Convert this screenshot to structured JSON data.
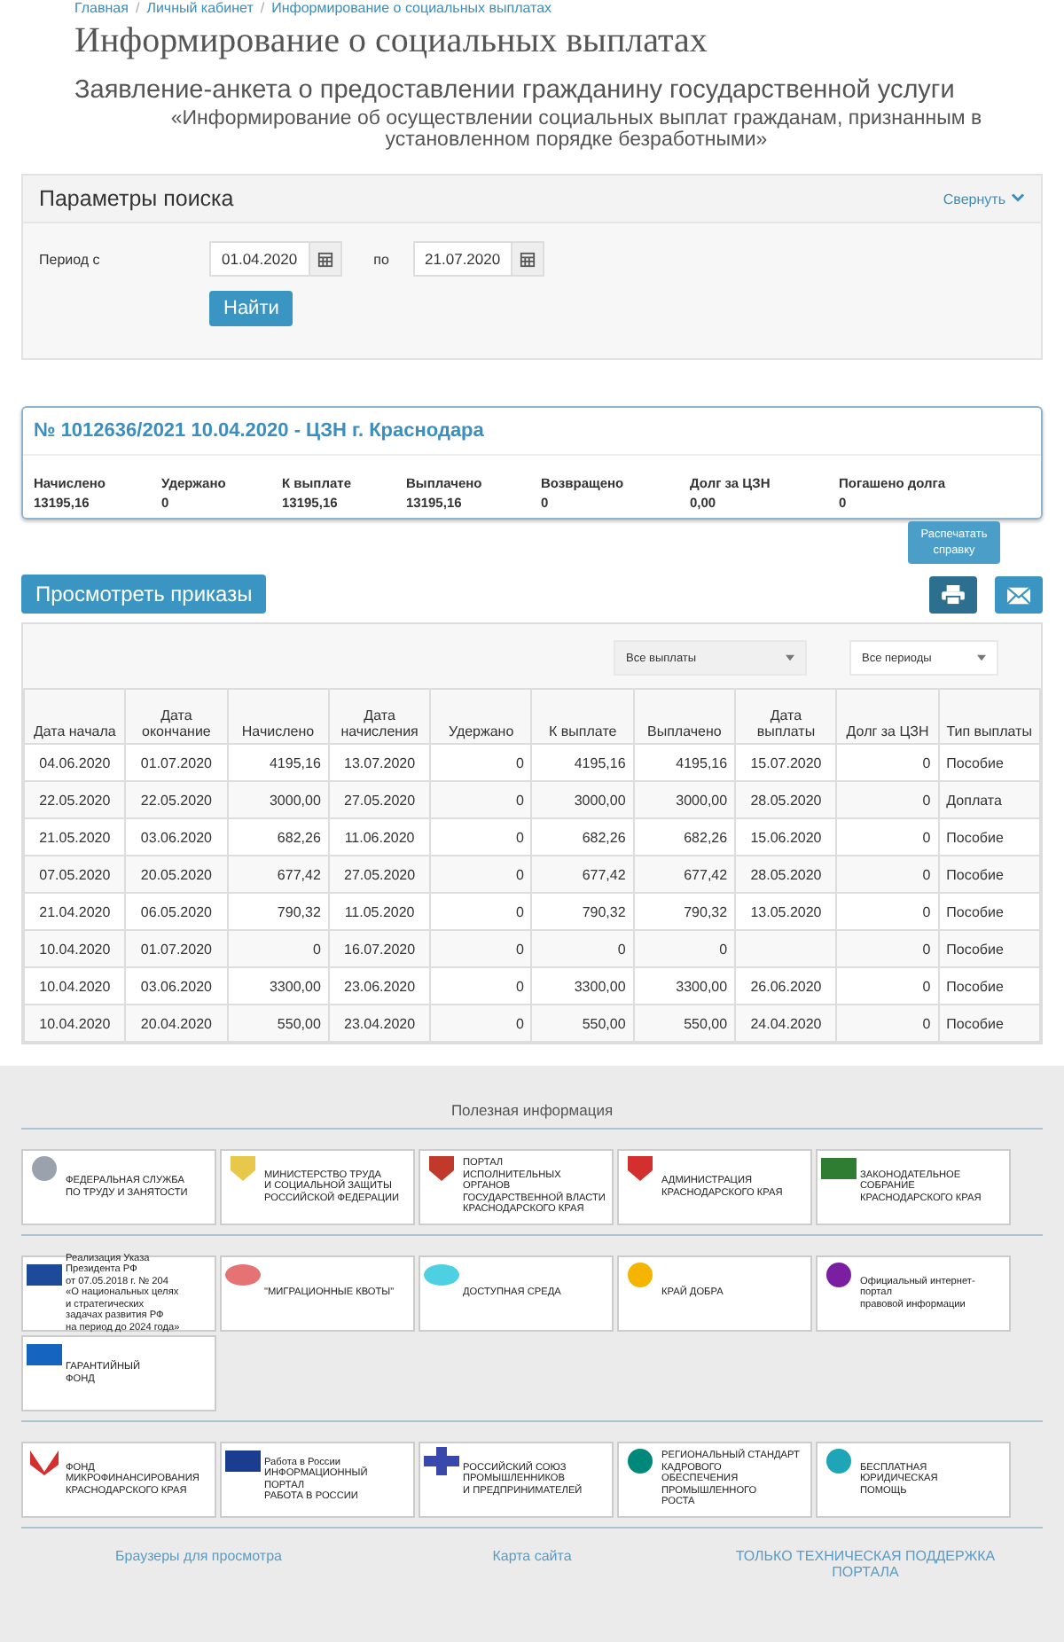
{
  "breadcrumb": {
    "separator": "/",
    "items": [
      "Главная",
      "Личный кабинет",
      "Информирование о социальных выплатах"
    ]
  },
  "title": "Информирование о социальных выплатах",
  "subtitle": "Заявление-анкета о предоставлении гражданину государственной услуги",
  "service_name": "«Информирование об осуществлении социальных выплат гражданам, признанным в установленном порядке безработными»",
  "search_panel": {
    "title": "Параметры поиска",
    "collapse_link": "Свернуть",
    "period_label": "Период с",
    "date_from": "01.04.2020",
    "to_label": "по",
    "date_to": "21.07.2020",
    "find_button": "Найти"
  },
  "summary": {
    "title": "№ 1012636/2021 10.04.2020 - ЦЗН г. Краснодара",
    "items": [
      {
        "label": "Начислено",
        "value": "13195,16"
      },
      {
        "label": "Удержано",
        "value": "0"
      },
      {
        "label": "К выплате",
        "value": "13195,16"
      },
      {
        "label": "Выплачено",
        "value": "13195,16"
      },
      {
        "label": "Возвращено",
        "value": "0"
      },
      {
        "label": "Долг за ЦЗН",
        "value": "0,00"
      },
      {
        "label": "Погашено долга",
        "value": "0"
      }
    ]
  },
  "actions": {
    "orders_button": "Просмотреть приказы",
    "print_tooltip": "Распечатать справку"
  },
  "table": {
    "filters": [
      "Все выплаты",
      "Все периоды"
    ],
    "columns": [
      {
        "label": "Дата начала",
        "kind": "date"
      },
      {
        "label": "Дата окончание",
        "kind": "date"
      },
      {
        "label": "Начислено",
        "kind": "number"
      },
      {
        "label": "Дата начисления",
        "kind": "date"
      },
      {
        "label": "Удержано",
        "kind": "number"
      },
      {
        "label": "К выплате",
        "kind": "number"
      },
      {
        "label": "Выплачено",
        "kind": "number"
      },
      {
        "label": "Дата выплаты",
        "kind": "date"
      },
      {
        "label": "Долг за ЦЗН",
        "kind": "number"
      },
      {
        "label": "Тип выплаты",
        "kind": "text"
      }
    ],
    "rows": [
      [
        "04.06.2020",
        "01.07.2020",
        "4195,16",
        "13.07.2020",
        "0",
        "4195,16",
        "4195,16",
        "15.07.2020",
        "0",
        "Пособие"
      ],
      [
        "22.05.2020",
        "22.05.2020",
        "3000,00",
        "27.05.2020",
        "0",
        "3000,00",
        "3000,00",
        "28.05.2020",
        "0",
        "Доплата"
      ],
      [
        "21.05.2020",
        "03.06.2020",
        "682,26",
        "11.06.2020",
        "0",
        "682,26",
        "682,26",
        "15.06.2020",
        "0",
        "Пособие"
      ],
      [
        "07.05.2020",
        "20.05.2020",
        "677,42",
        "27.05.2020",
        "0",
        "677,42",
        "677,42",
        "28.05.2020",
        "0",
        "Пособие"
      ],
      [
        "21.04.2020",
        "06.05.2020",
        "790,32",
        "11.05.2020",
        "0",
        "790,32",
        "790,32",
        "13.05.2020",
        "0",
        "Пособие"
      ],
      [
        "10.04.2020",
        "01.07.2020",
        "0",
        "16.07.2020",
        "0",
        "0",
        "0",
        null,
        "0",
        "Пособие"
      ],
      [
        "10.04.2020",
        "03.06.2020",
        "3300,00",
        "23.06.2020",
        "0",
        "3300,00",
        "3300,00",
        "26.06.2020",
        "0",
        "Пособие"
      ],
      [
        "10.04.2020",
        "20.04.2020",
        "550,00",
        "23.04.2020",
        "0",
        "550,00",
        "550,00",
        "24.04.2020",
        "0",
        "Пособие"
      ]
    ]
  },
  "footer": {
    "title": "Полезная информация",
    "banner_rows": [
      [
        {
          "kind": "emblem",
          "text": "ФЕДЕРАЛЬНАЯ СЛУЖБА\nПО ТРУДУ И ЗАНЯТОСТИ"
        },
        {
          "kind": "shield",
          "text": "МИНИСТЕРСТВО ТРУДА\nИ СОЦИАЛЬНОЙ ЗАЩИТЫ\nРОССИЙСКОЙ ФЕДЕРАЦИИ"
        },
        {
          "kind": "crest",
          "text": "ПОРТАЛ\nИСПОЛНИТЕЛЬНЫХ ОРГАНОВ\nГОСУДАРСТВЕННОЙ ВЛАСТИ\nКРАСНОДАРСКОГО КРАЯ"
        },
        {
          "kind": "red-crest",
          "text": "АДМИНИСТРАЦИЯ\nКРАСНОДАРСКОГО КРАЯ"
        },
        {
          "kind": "flag",
          "text": "ЗАКОНОДАТЕЛЬНОЕ\nСОБРАНИЕ\nКРАСНОДАРСКОГО КРАЯ"
        }
      ],
      [
        {
          "kind": "projects",
          "text": "Реализация Указа\nПрезидента РФ\nот 07.05.2018 г. № 204\n«О национальных целях\nи стратегических\nзадачах развития РФ\nна период до 2024 года»"
        },
        {
          "kind": "map",
          "text": "\"МИГРАЦИОННЫЕ КВОТЫ\""
        },
        {
          "kind": "cloud",
          "text": "ДОСТУПНАЯ СРЕДА"
        },
        {
          "kind": "dots",
          "text": "КРАЙ ДОБРА"
        },
        {
          "kind": "seal",
          "text": "Официальный интернет-портал\nправовой информации"
        },
        {
          "kind": "stripes",
          "text": "ГАРАНТИЙНЫЙ\nФОНД"
        }
      ],
      [
        {
          "kind": "check",
          "text": "ФОНД\nМИКРОФИНАНСИРОВАНИЯ\nКРАСНОДАРСКОГО КРАЯ"
        },
        {
          "kind": "label",
          "text": "Работа в России\nИНФОРМАЦИОННЫЙ ПОРТАЛ\nРАБОТА В РОССИИ"
        },
        {
          "kind": "cross",
          "text": "РОССИЙСКИЙ СОЮЗ\nПРОМЫШЛЕННИКОВ\nИ ПРЕДПРИНИМАТЕЛЕЙ"
        },
        {
          "kind": "ring",
          "text": "РЕГИОНАЛЬНЫЙ СТАНДАРТ КАДРОВОГО\nОБЕСПЕЧЕНИЯ ПРОМЫШЛЕННОГО\nРОСТА"
        },
        {
          "kind": "cap",
          "text": "БЕСПЛАТНАЯ ЮРИДИЧЕСКАЯ\nПОМОЩЬ"
        }
      ]
    ],
    "links": [
      "Браузеры для просмотра",
      "Карта сайта",
      "ТОЛЬКО ТЕХНИЧЕСКАЯ ПОДДЕРЖКА ПОРТАЛА"
    ]
  }
}
